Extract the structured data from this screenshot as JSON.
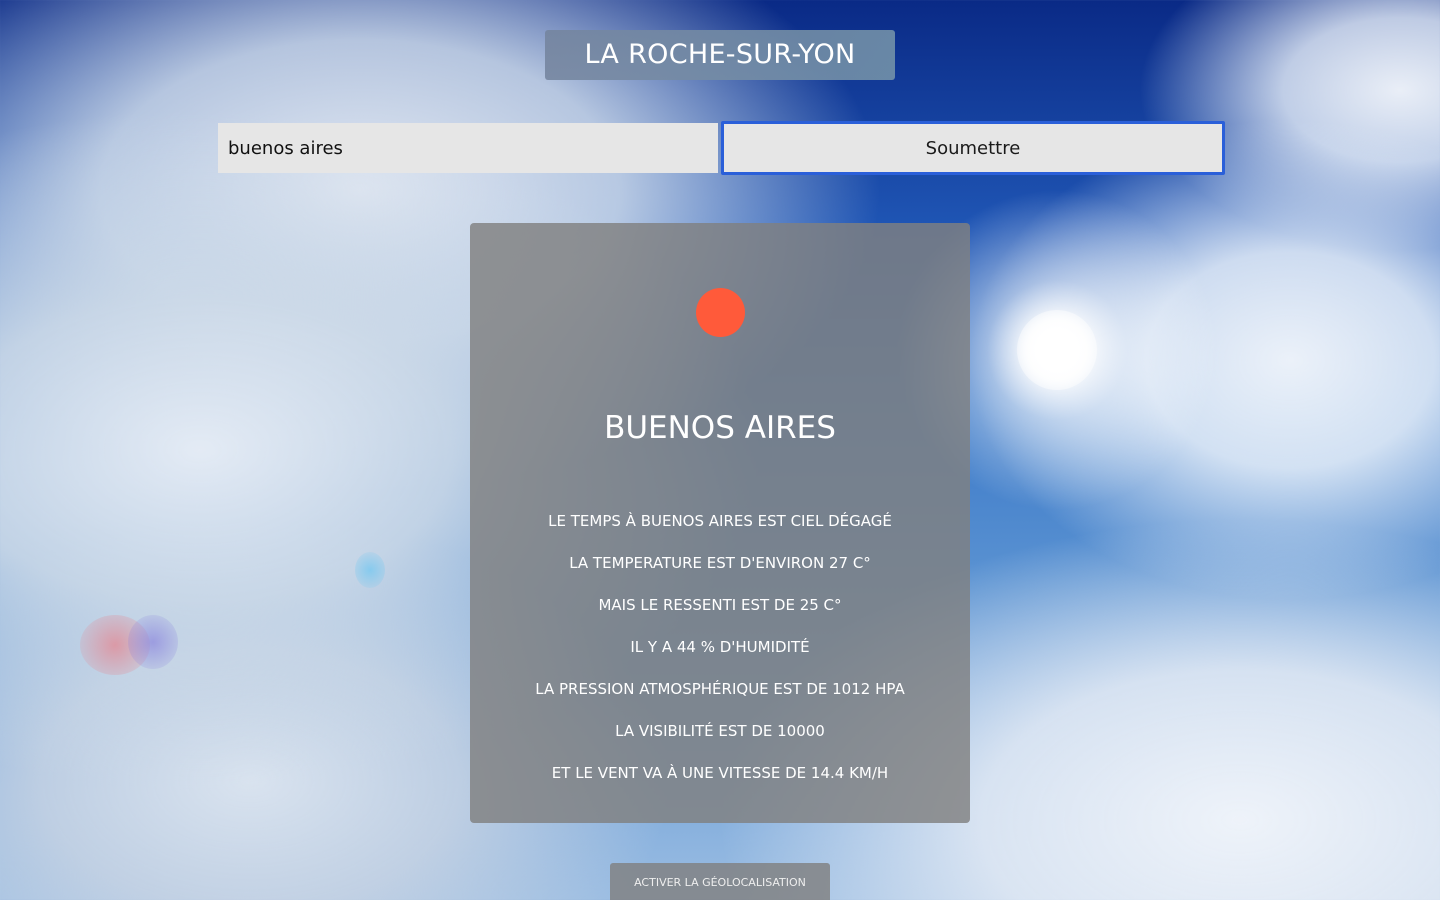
{
  "header": {
    "city_title": "LA ROCHE-SUR-YON"
  },
  "search": {
    "value": "buenos aires",
    "submit_label": "Soumettre"
  },
  "weather_card": {
    "status_color": "#ff5a3a",
    "city_name": "BUENOS AIRES",
    "details": [
      "LE TEMPS À BUENOS AIRES EST CIEL DÉGAGÉ",
      "LA TEMPERATURE EST D'ENVIRON 27 C°",
      "MAIS LE RESSENTI EST DE 25 C°",
      "IL Y A 44 % D'HUMIDITÉ",
      "LA PRESSION ATMOSPHÉRIQUE EST DE 1012 HPA",
      "LA VISIBILITÉ EST DE 10000",
      "ET LE VENT VA À UNE VITESSE DE 14.4 KM/H"
    ]
  },
  "footer": {
    "geolocation_label": "ACTIVER LA GÉOLOCALISATION"
  }
}
